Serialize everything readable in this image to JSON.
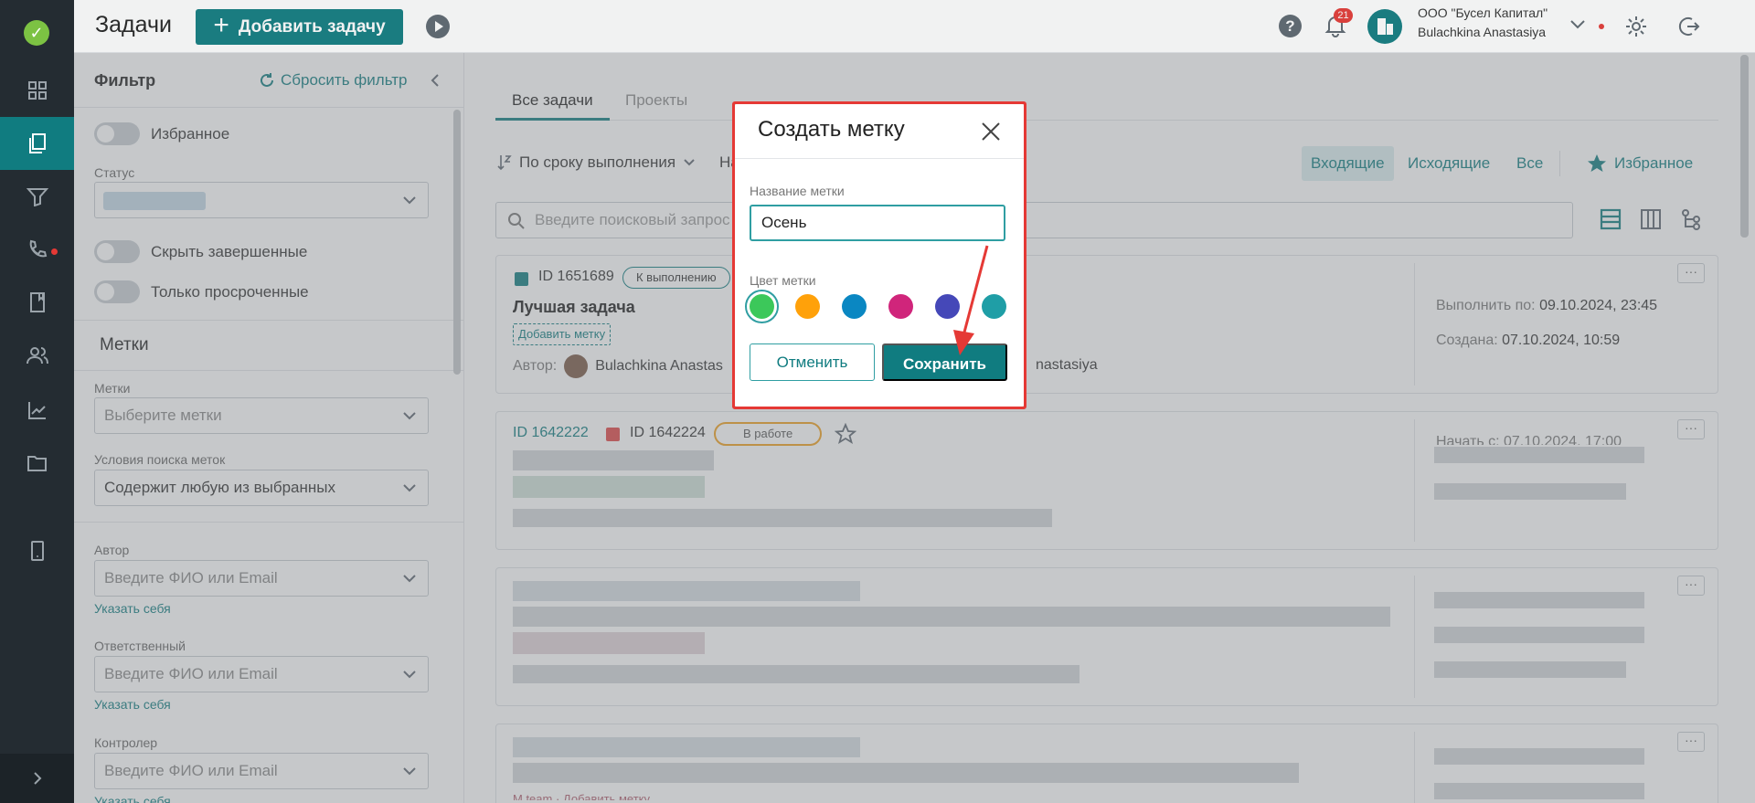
{
  "topbar": {
    "title": "Задачи",
    "add_task_label": "Добавить задачу",
    "notifications_count": "21",
    "org_name": "ООО \"Бусел Капитал\"",
    "user_name": "Bulachkina Anastasiya"
  },
  "filter": {
    "title": "Фильтр",
    "reset_label": "Сбросить фильтр",
    "favorites_toggle": "Избранное",
    "status_label": "Статус",
    "hide_completed": "Скрыть завершенные",
    "only_overdue": "Только просроченные",
    "labels_section": "Метки",
    "labels_field_label": "Метки",
    "labels_placeholder": "Выберите метки",
    "label_search_conditions": "Условия поиска меток",
    "label_search_value": "Содержит любую из выбранных",
    "author_label": "Автор",
    "author_placeholder": "Введите ФИО или Email",
    "author_self": "Указать себя",
    "responsible_label": "Ответственный",
    "responsible_placeholder": "Введите ФИО или Email",
    "responsible_self": "Указать себя",
    "controller_label": "Контролер",
    "controller_placeholder": "Введите ФИО или Email",
    "controller_self": "Указать себя"
  },
  "main": {
    "tabs": [
      {
        "label": "Все задачи",
        "active": true
      },
      {
        "label": "Проекты",
        "active": false
      }
    ],
    "sort_label": "По сроку выполнения",
    "sort_second_cut": "На",
    "segments": [
      {
        "label": "Входящие",
        "active": true
      },
      {
        "label": "Исходящие",
        "active": false
      },
      {
        "label": "Все",
        "active": false
      }
    ],
    "favorites_label": "Избранное",
    "search_placeholder": "Введите поисковый запрос",
    "cards": [
      {
        "id": "ID 1651689",
        "status": "К выполнению",
        "title": "Лучшая задача",
        "add_label": "Добавить метку",
        "author_prefix": "Автор:",
        "author_name": "Bulachkina Anastas",
        "responsible_name_cut": "nastasiya",
        "due_prefix": "Выполнить по:",
        "due_value": "09.10.2024, 23:45",
        "created_prefix": "Создана:",
        "created_value": "07.10.2024, 10:59"
      },
      {
        "parent_id": "ID 1642222",
        "id": "ID 1642224",
        "status": "В работе",
        "start_partial": "Начать с: 07.10.2024, 17:00"
      }
    ],
    "partial_label_text": "M team · Добавить метку"
  },
  "modal": {
    "title": "Создать метку",
    "name_label": "Название метки",
    "name_value": "Осень",
    "color_label": "Цвет метки",
    "colors": [
      "#3cc85a",
      "#ffa10a",
      "#0a87c2",
      "#d0257b",
      "#4548b8",
      "#1f9ea6"
    ],
    "selected_color": "#3cc85a",
    "cancel_label": "Отменить",
    "save_label": "Сохранить"
  },
  "colors": {
    "accent": "#107c80",
    "highlight": "#e53935"
  }
}
